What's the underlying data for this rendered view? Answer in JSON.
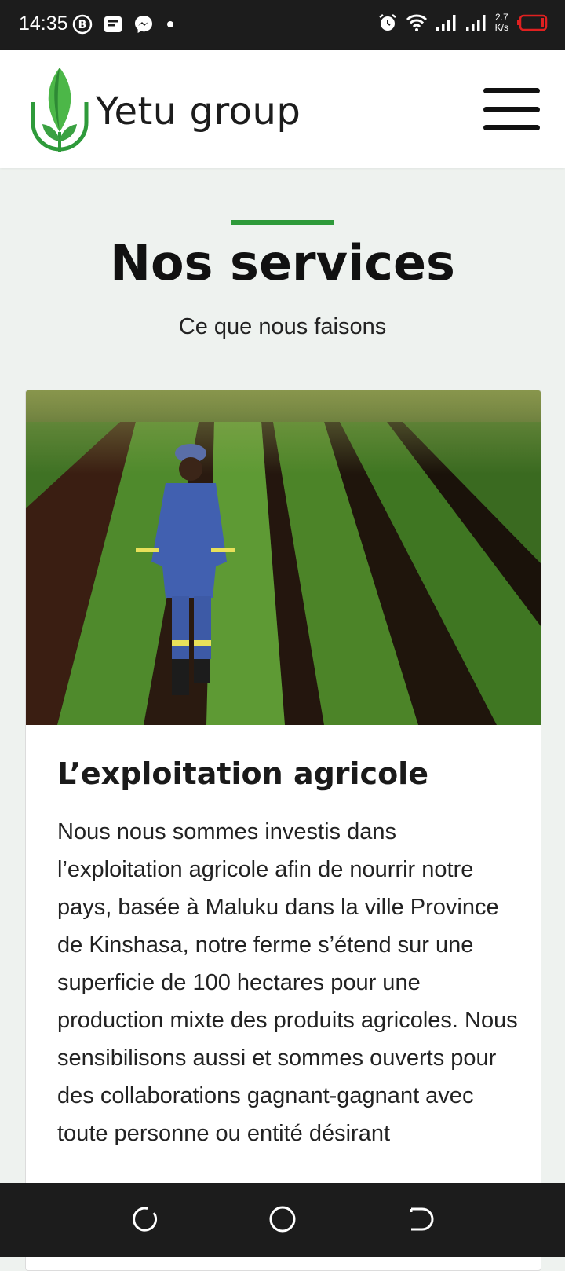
{
  "status_bar": {
    "time": "14:35",
    "network_speed_value": "2.7",
    "network_speed_unit": "K/s",
    "icons": [
      "b-app-icon",
      "message-icon",
      "messenger-icon",
      "dot-icon",
      "alarm-icon",
      "wifi-icon",
      "signal-icon",
      "signal-icon",
      "battery-icon"
    ]
  },
  "header": {
    "brand": "Yetu group",
    "logo_icon": "leaf-logo-icon",
    "menu_icon": "hamburger-menu-icon",
    "accent_color": "#2e9a3a"
  },
  "section": {
    "title": "Nos services",
    "subtitle": "Ce que nous faisons"
  },
  "card": {
    "image": "farmer-in-field-photo",
    "title": "L’exploitation agricole",
    "body": "Nous nous sommes investis dans l’exploitation agricole afin de nourrir notre pays, basée à Maluku dans la ville Province de Kinshasa, notre ferme s’étend sur une superficie de 100 hectares pour une production mixte des produits agricoles. Nous sensibilisons aussi et sommes ouverts pour des collaborations gagnant-gagnant avec toute personne ou entité désirant"
  },
  "nav_bar": {
    "icons": [
      "recent-apps-icon",
      "home-icon",
      "back-icon"
    ]
  }
}
